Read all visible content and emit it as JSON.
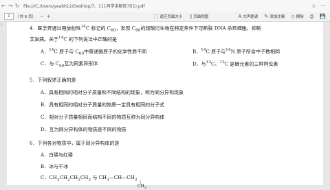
{
  "browser": {
    "back": "←",
    "forward": "→",
    "refresh": "↻",
    "url": "file:///C:/Users/yeabh12/Desktop/7、111同学讲解练习(1).pdf",
    "star": "☆",
    "menu": "⋯"
  },
  "toolbar": {
    "page_current": "1",
    "page_total": "（共 6 页）",
    "zoom_out": "−",
    "zoom_in": "+",
    "fit_label": "适应页面大小",
    "view_label": "页面视图",
    "read_aloud_label": "大声朗读",
    "draw_label": "添加注释",
    "erase_label": "擦除",
    "print": "⎙",
    "save": "💾"
  },
  "document": {
    "left_marker": "1",
    "q4": {
      "stem_a": "4．医学界通过用放射性",
      "stem_a_sup": "14",
      "stem_b": "C 标记的 C",
      "stem_b_sub": "60",
      "stem_c": "，发现 C",
      "stem_c_sub": "60",
      "stem_d": "的羧酸衍生物在特定条件下可断裂 DNA 杀死细胞，抑制",
      "stem2_a": "艾滋病。关于",
      "stem2_sup": "14",
      "stem2_b": "C 的下列说法中正确的是",
      "a_1": "A．",
      "a_sup": "14",
      "a_2": "C 原子与 C",
      "a_sub": "60",
      "a_3": "中普通碳原子的化学性质不同",
      "b_1": "B．",
      "b_sup1": "14",
      "b_2": "C 原子与",
      "b_sup2": "14",
      "b_3": "N 原子所含中子数相同",
      "c_1": "C．与 C",
      "c_sub": "60",
      "c_2": "互为同素异形体",
      "d_1": "D．与",
      "d_sup1": "12",
      "d_2": "C、",
      "d_sup2": "13",
      "d_3": "C 是碳元素的三种同位素"
    },
    "q5": {
      "stem": "5．下列叙述正确的是",
      "a": "A．具有相同的相对分子质量和不同结构的现象，称为同分异构现象",
      "b": "B．具有相同的相对分子质量的物质一定具有相同的分子式",
      "c": "C．相对分子质量相同而结构不同的物质互称为同分异构体",
      "d": "D．互为同分异构体的物质是不同的物质"
    },
    "q6": {
      "stem": "6．下列各对物质中，属于同分异构体的是",
      "a": "A．白磷与红磷",
      "b": "B．冰与干冰",
      "c_1": "C．CH",
      "c_sub1": "3",
      "c_2": "CH",
      "c_sub2": "2",
      "c_3": "CH",
      "c_sub3": "2",
      "c_4": "CH",
      "c_sub4": "3",
      "c_5": " 与 CH",
      "c_sub5": "3",
      "c_6": "—CH—CH",
      "c_sub6": "3",
      "c_branch": "CH",
      "c_branch_sub": "3"
    }
  }
}
